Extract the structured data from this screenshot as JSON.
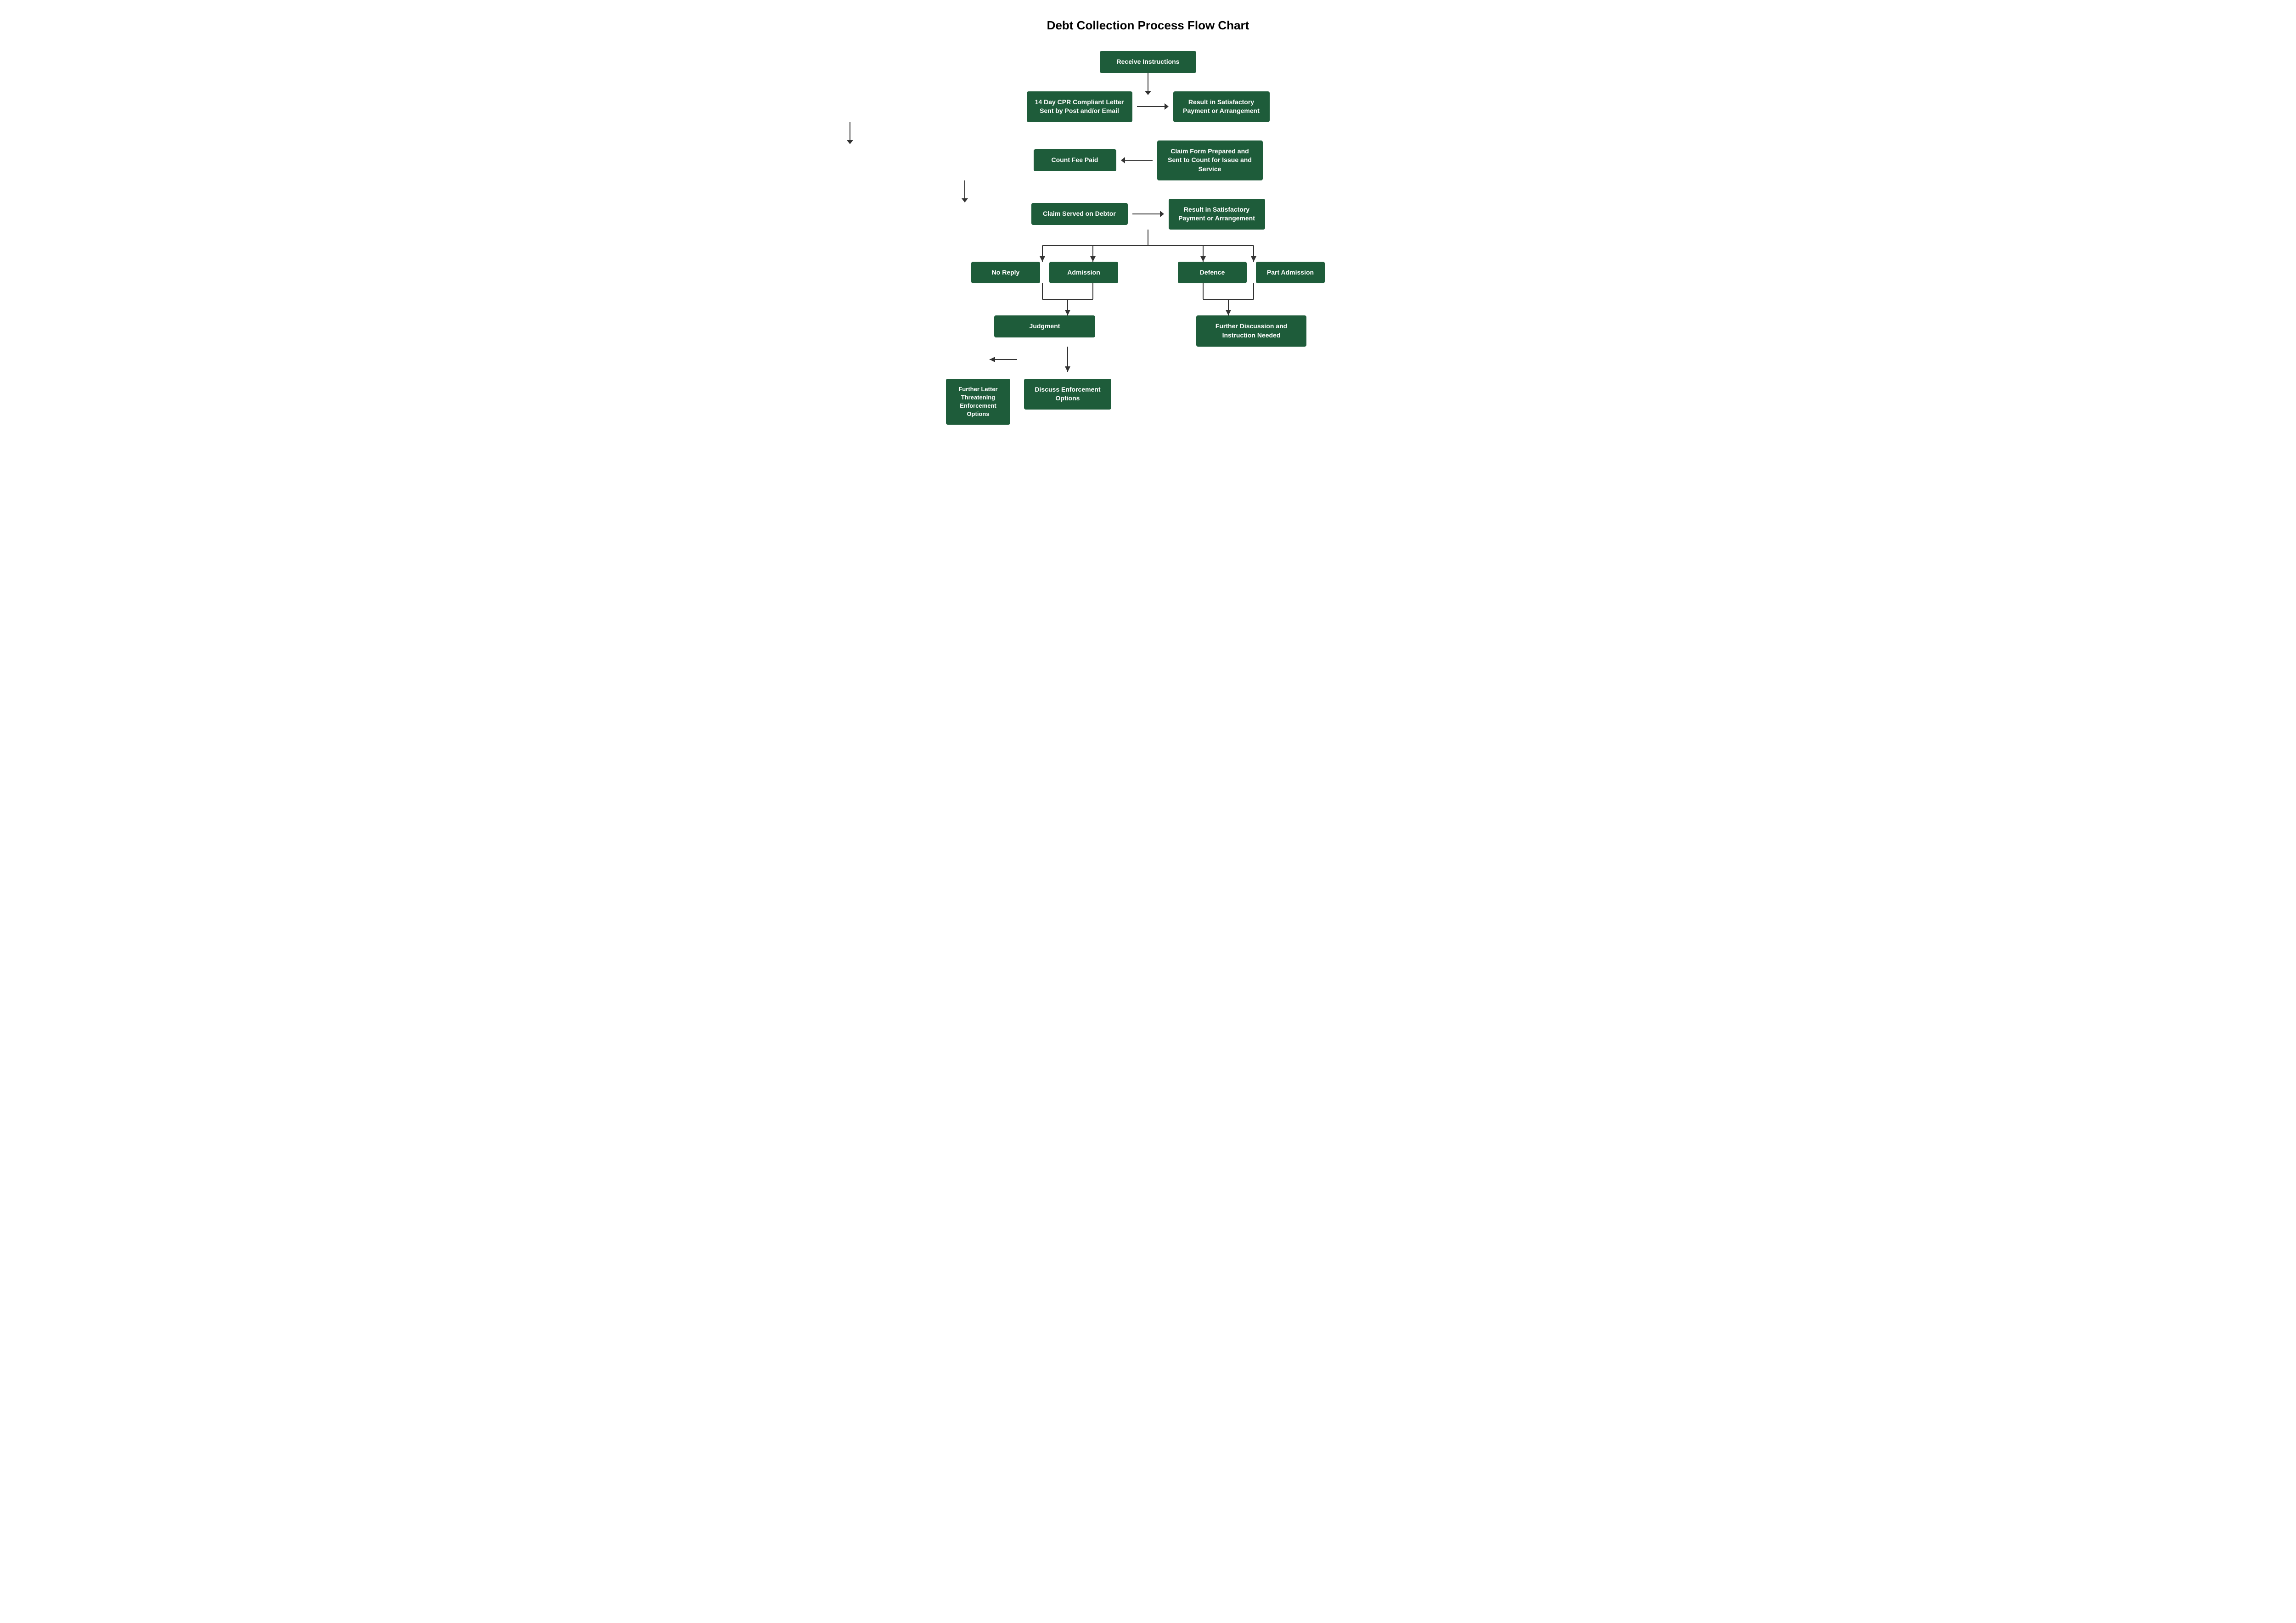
{
  "title": "Debt Collection Process Flow Chart",
  "boxes": {
    "receive_instructions": "Receive Instructions",
    "cpr_letter": "14 Day CPR Compliant Letter Sent by Post and/or Email",
    "result_satisfactory_1": "Result in Satisfactory Payment or Arrangement",
    "claim_form": "Claim Form Prepared and Sent to Count for Issue and Service",
    "count_fee_paid": "Count Fee Paid",
    "claim_served": "Claim Served on Debtor",
    "result_satisfactory_2": "Result in Satisfactory Payment or Arrangement",
    "no_reply": "No Reply",
    "admission": "Admission",
    "defence": "Defence",
    "part_admission": "Part Admission",
    "judgment": "Judgment",
    "further_discussion": "Further Discussion and Instruction Needed",
    "discuss_enforcement": "Discuss Enforcement Options",
    "further_letter": "Further Letter Threatening Enforcement Options"
  }
}
